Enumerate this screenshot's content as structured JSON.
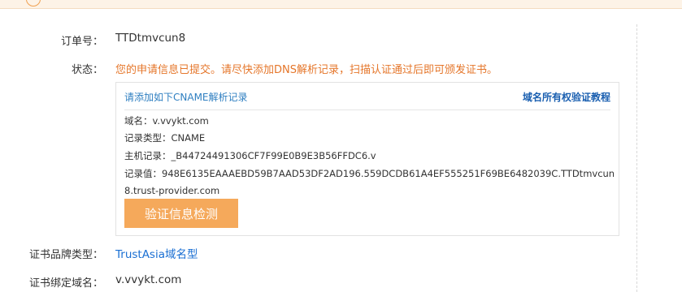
{
  "order": {
    "label": "订单号：",
    "value": "TTDtmvcun8"
  },
  "status": {
    "label": "状态：",
    "text": "您的申请信息已提交。请尽快添加DNS解析记录，扫描认证通过后即可颁发证书。"
  },
  "cname_box": {
    "title": "请添加如下CNAME解析记录",
    "guide_link": "域名所有权验证教程",
    "domain_line": "域名：v.vvykt.com",
    "type_line": "记录类型：CNAME",
    "host_line": "主机记录：_B44724491306CF7F99E0B9E3B56FFDC6.v",
    "value_line1": "记录值：948E6135EAAAEBD59B7AAD53DF2AD196.559DCDB61A4EF555251F69BE6482039C.TTDtmvcun",
    "value_line2": "8.trust-provider.com",
    "check_button": "验证信息检测"
  },
  "brand": {
    "label": "证书品牌类型：",
    "value": "TrustAsia域名型"
  },
  "bound_domain": {
    "label": "证书绑定域名：",
    "value": "v.vvykt.com"
  },
  "colors": {
    "status": "#e5762a",
    "button": "#f5a95b",
    "link": "#1a6fd3",
    "banner": "#fdf3e7"
  }
}
